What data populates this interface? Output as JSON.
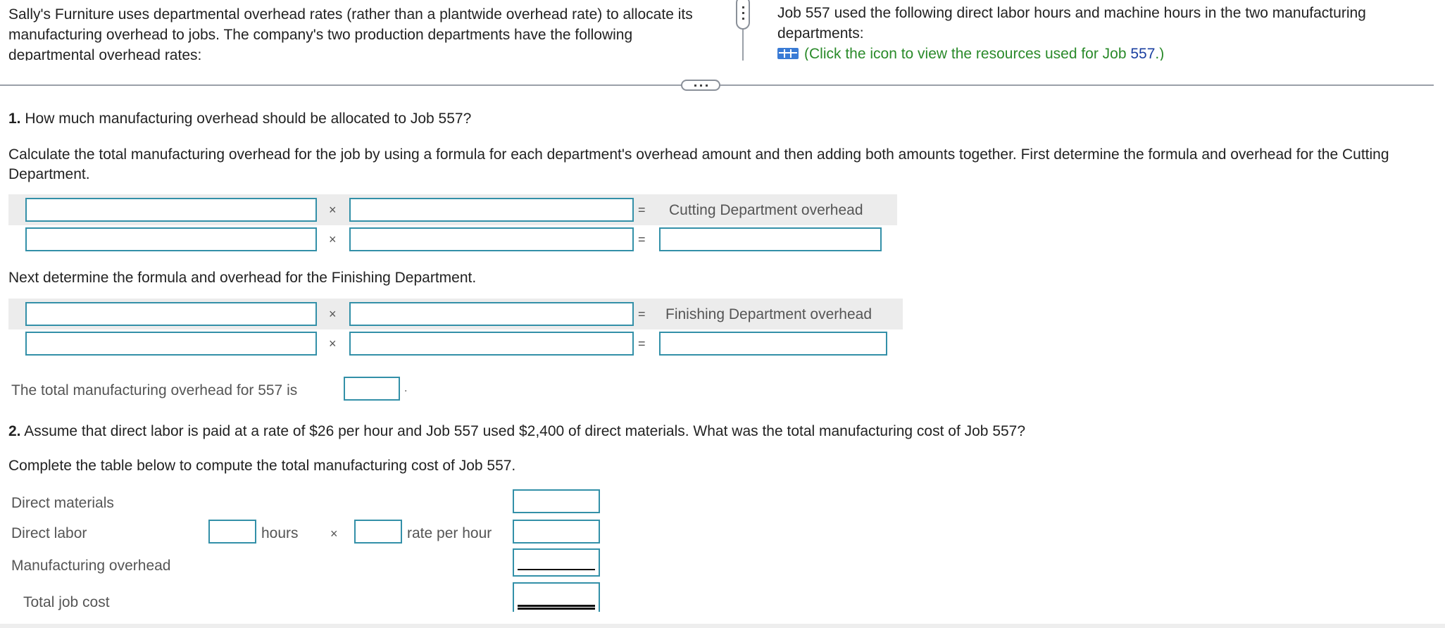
{
  "header": {
    "intro_left": "Sally's Furniture uses departmental overhead rates (rather than a plantwide overhead rate) to allocate its manufacturing overhead to jobs. The company's two production departments have the following departmental overhead rates:",
    "intro_right": "Job 557 used the following direct labor hours and machine hours in the two manufacturing departments:",
    "resource_link_text": "(Click the icon to view the resources used for Job ",
    "resource_link_number": "557",
    "resource_link_suffix": ".)",
    "table_icon": "table-grid-icon"
  },
  "question1": {
    "number": "1.",
    "text": "How much manufacturing overhead should be allocated to Job 557?",
    "instructions": "Calculate the total manufacturing overhead for the job by using a formula for each department's overhead amount and then adding both amounts together. First determine the formula and overhead for the Cutting Department.",
    "cutting": {
      "times": "×",
      "equals": "=",
      "result_label": "Cutting Department overhead",
      "inputs": {
        "a_header": "",
        "b_header": "",
        "a_value": "",
        "b_value": "",
        "result": ""
      }
    },
    "finishing_intro": "Next determine the formula and overhead for the Finishing Department.",
    "finishing": {
      "times": "×",
      "equals": "=",
      "result_label": "Finishing Department overhead",
      "inputs": {
        "a_header": "",
        "b_header": "",
        "a_value": "",
        "b_value": "",
        "result": ""
      }
    },
    "total_text": "The total manufacturing overhead for 557 is",
    "total_value": "",
    "total_period": "."
  },
  "question2": {
    "number": "2.",
    "text": "Assume that direct labor is paid at a rate of $26 per hour and Job 557 used $2,400 of direct materials. What was the total manufacturing cost of Job 557?",
    "instructions": "Complete the table below to compute the total manufacturing cost of Job 557.",
    "rows": {
      "direct_materials": "Direct materials",
      "direct_labor": "Direct labor",
      "hours_label": "hours",
      "times": "×",
      "rate_label": "rate per hour",
      "manufacturing_overhead": "Manufacturing overhead",
      "total_job_cost": "Total job cost"
    },
    "values": {
      "dm": "",
      "hours": "",
      "rate": "",
      "dl": "",
      "moh": "",
      "total": ""
    }
  },
  "colors": {
    "input_border": "#3390a8",
    "link_green": "#2a8a2a",
    "band_gray": "#ececec"
  }
}
